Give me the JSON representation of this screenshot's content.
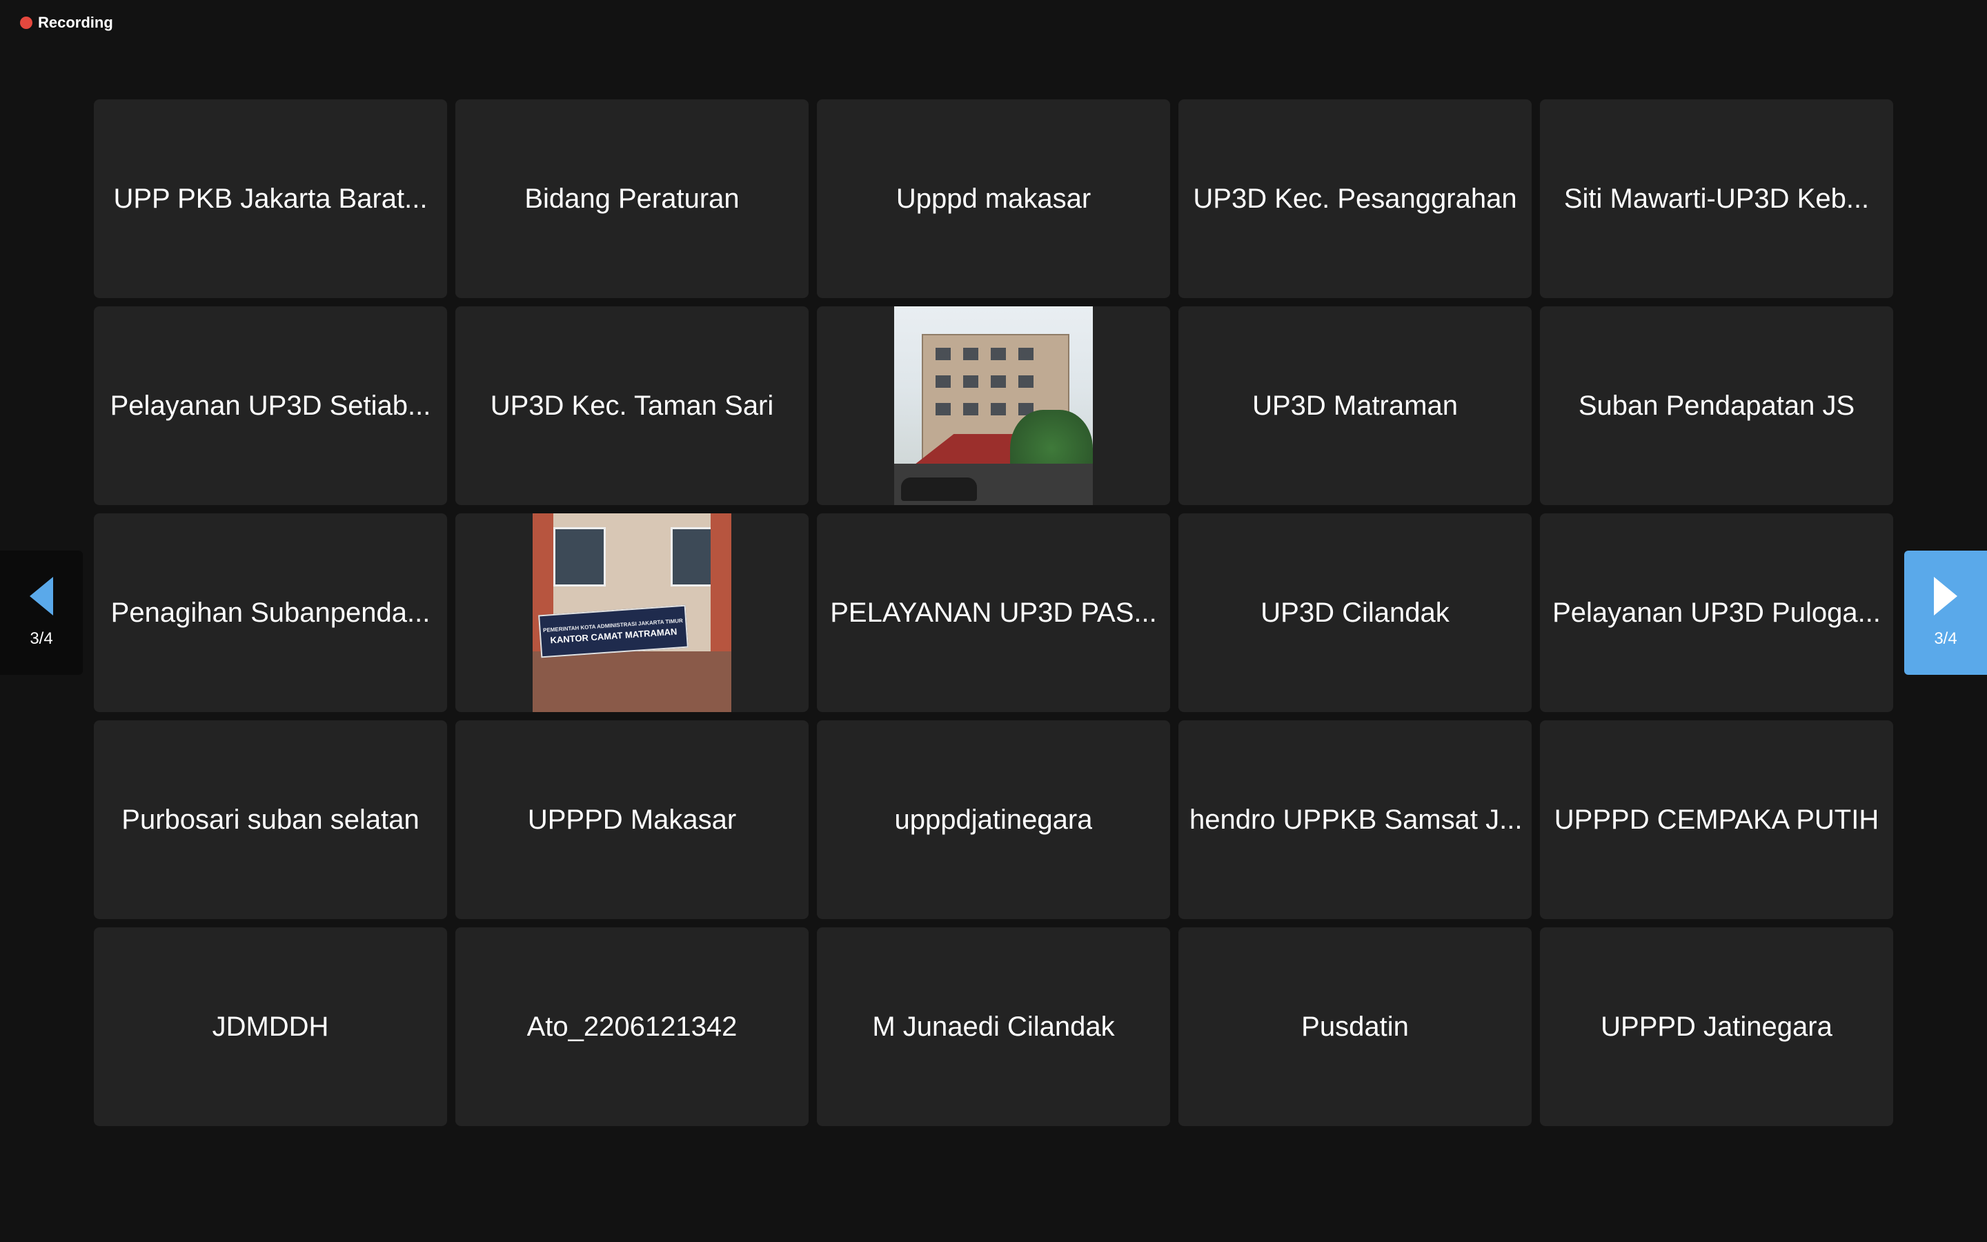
{
  "recording": {
    "label": "Recording",
    "dot_color": "#e5483e"
  },
  "pagination": {
    "prev_label": "3/4",
    "next_label": "3/4",
    "accent_color": "#5aa9ea"
  },
  "tiles": [
    {
      "name": "UPP PKB Jakarta Barat..."
    },
    {
      "name": "Bidang Peraturan"
    },
    {
      "name": "Upppd makasar"
    },
    {
      "name": "UP3D Kec. Pesanggrahan"
    },
    {
      "name": "Siti Mawarti-UP3D Keb..."
    },
    {
      "name": "Pelayanan UP3D Setiab..."
    },
    {
      "name": "UP3D Kec. Taman Sari"
    },
    {
      "name": "",
      "image": "building-photo"
    },
    {
      "name": "UP3D Matraman"
    },
    {
      "name": "Suban Pendapatan JS"
    },
    {
      "name": "Penagihan Subanpenda..."
    },
    {
      "name": "",
      "image": "kantor-camat-photo",
      "sign_text": "KANTOR CAMAT MATRAMAN",
      "sign_subtext": "PEMERINTAH KOTA ADMINISTRASI JAKARTA TIMUR"
    },
    {
      "name": "PELAYANAN UP3D PAS..."
    },
    {
      "name": "UP3D Cilandak"
    },
    {
      "name": "Pelayanan UP3D Puloga..."
    },
    {
      "name": "Purbosari suban selatan"
    },
    {
      "name": "UPPPD Makasar"
    },
    {
      "name": "upppdjatinegara"
    },
    {
      "name": "hendro UPPKB Samsat J..."
    },
    {
      "name": "UPPPD CEMPAKA PUTIH"
    },
    {
      "name": "JDMDDH"
    },
    {
      "name": "Ato_2206121342"
    },
    {
      "name": "M Junaedi Cilandak"
    },
    {
      "name": "Pusdatin"
    },
    {
      "name": "UPPPD Jatinegara"
    }
  ]
}
